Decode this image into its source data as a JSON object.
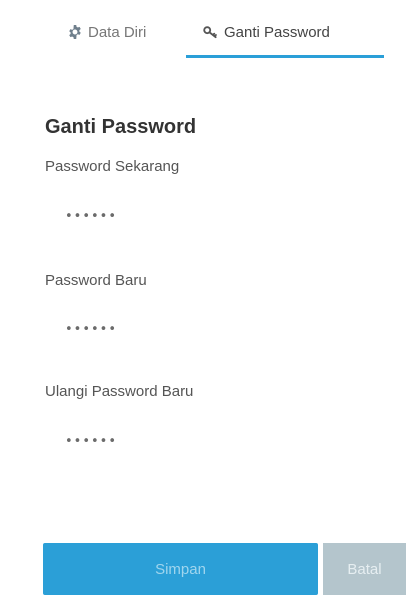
{
  "tabs": {
    "data_diri": {
      "label": "Data Diri",
      "icon": "gear-icon"
    },
    "ganti_password": {
      "label": "Ganti Password",
      "icon": "key-icon",
      "active": true
    }
  },
  "form": {
    "title": "Ganti Password",
    "current_password": {
      "label": "Password Sekarang",
      "value": "••••••"
    },
    "new_password": {
      "label": "Password Baru",
      "value": "••••••"
    },
    "repeat_password": {
      "label": "Ulangi Password Baru",
      "value": "••••••"
    }
  },
  "actions": {
    "save_label": "Simpan",
    "cancel_label": "Batal"
  },
  "colors": {
    "accent": "#2a9fd8",
    "cancel": "#b4c5cc"
  }
}
